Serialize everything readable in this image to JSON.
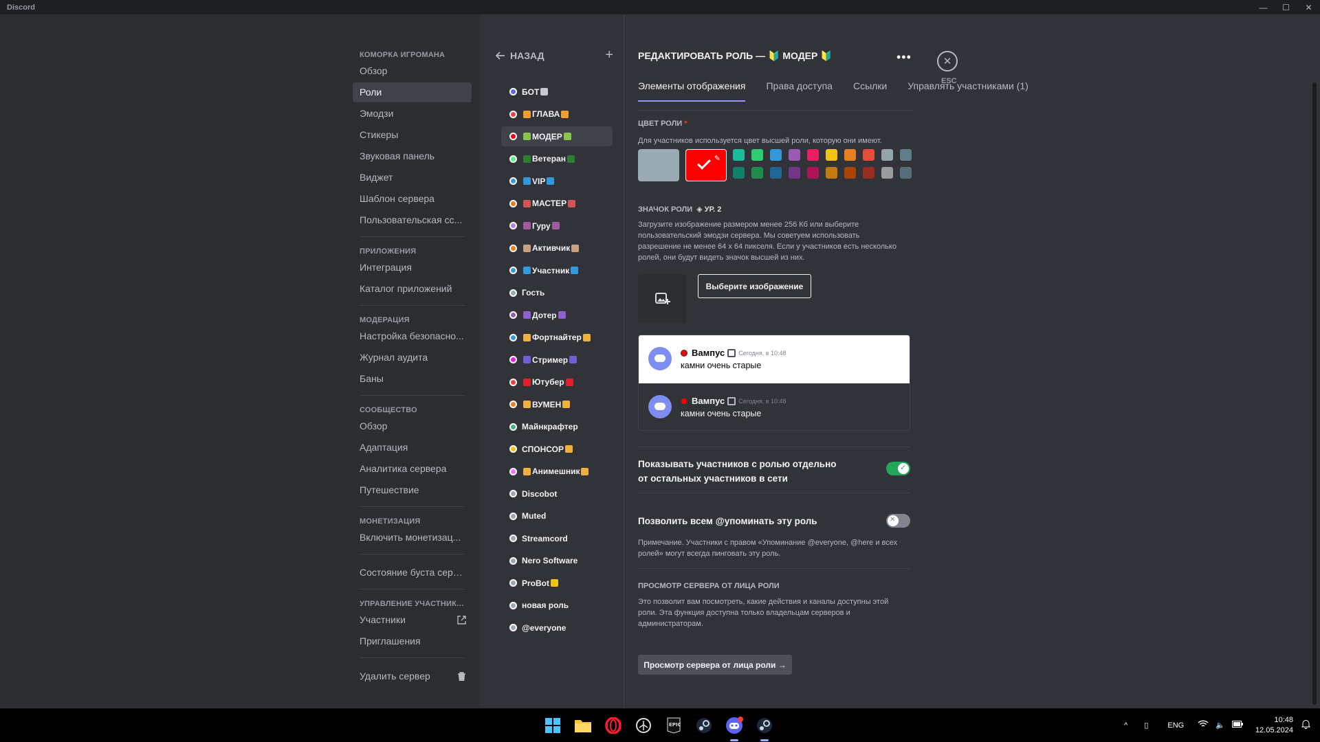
{
  "window": {
    "title": "Discord"
  },
  "sidebar": {
    "sections": [
      {
        "header": "КОМОРКА ИГРОМАНА",
        "items": [
          "Обзор",
          "Роли",
          "Эмодзи",
          "Стикеры",
          "Звуковая панель",
          "Виджет",
          "Шаблон сервера",
          "Пользовательская сс..."
        ]
      },
      {
        "header": "ПРИЛОЖЕНИЯ",
        "items": [
          "Интеграция",
          "Каталог приложений"
        ]
      },
      {
        "header": "МОДЕРАЦИЯ",
        "items": [
          "Настройка безопасно...",
          "Журнал аудита",
          "Баны"
        ]
      },
      {
        "header": "СООБЩЕСТВО",
        "items": [
          "Обзор",
          "Адаптация",
          "Аналитика сервера",
          "Путешествие"
        ]
      },
      {
        "header": "МОНЕТИЗАЦИЯ",
        "items": [
          "Включить монетизац..."
        ]
      },
      {
        "header": "",
        "items": [
          "Состояние буста сервера"
        ]
      },
      {
        "header": "УПРАВЛЕНИЕ УЧАСТНИКА...",
        "items": [
          "Участники",
          "Приглашения"
        ]
      },
      {
        "header": "",
        "items": [
          "Удалить сервер"
        ]
      }
    ],
    "active_item": "Роли"
  },
  "roles": {
    "back_label": "НАЗАД",
    "items": [
      {
        "name": "БОТ",
        "color": "#5865f2",
        "pre": "",
        "post": "#c7c7d0"
      },
      {
        "name": "ГЛАВА",
        "color": "#f23f43",
        "pre": "#f0a030",
        "post": "#f0a030"
      },
      {
        "name": "МОДЕР",
        "color": "#ff0000",
        "pre": "#8bc34a",
        "post": "#8bc34a"
      },
      {
        "name": "Ветеран",
        "color": "#57f287",
        "pre": "#2e7d32",
        "post": "#2e7d32"
      },
      {
        "name": "VIP",
        "color": "#3498db",
        "pre": "#3498db",
        "post": "#3498db"
      },
      {
        "name": "МАСТЕР",
        "color": "#e67e22",
        "pre": "#d35454",
        "post": "#d35454"
      },
      {
        "name": "Гуру",
        "color": "#c27ce0",
        "pre": "#a05aa0",
        "post": "#a05aa0"
      },
      {
        "name": "Активчик",
        "color": "#e67e22",
        "pre": "#c9a080",
        "post": "#c9a080"
      },
      {
        "name": "Участник",
        "color": "#3498db",
        "pre": "#3498db",
        "post": "#3498db"
      },
      {
        "name": "Гость",
        "color": "#99aab5",
        "pre": "",
        "post": ""
      },
      {
        "name": "Дотер",
        "color": "#9b59b6",
        "pre": "#8e5fd0",
        "post": "#8e5fd0"
      },
      {
        "name": "Фортнайтер",
        "color": "#3498db",
        "pre": "#f0b040",
        "post": "#f0b040"
      },
      {
        "name": "Стример",
        "color": "#e91ee3",
        "pre": "#6f5fd6",
        "post": "#6f5fd6"
      },
      {
        "name": "Ютубер",
        "color": "#f23f43",
        "pre": "#e0202a",
        "post": "#e0202a"
      },
      {
        "name": "ВУМЕН",
        "color": "#e67e22",
        "pre": "#f0b040",
        "post": "#f0b040"
      },
      {
        "name": "Майнкрафтер",
        "color": "#43b581",
        "pre": "",
        "post": ""
      },
      {
        "name": "СПОНСОР",
        "color": "#f1c40f",
        "pre": "",
        "post": "#f0b040"
      },
      {
        "name": "Анимешник",
        "color": "#ff73fa",
        "pre": "#f0b040",
        "post": "#f0b040"
      },
      {
        "name": "Discobot",
        "color": "#99aab5",
        "pre": "",
        "post": ""
      },
      {
        "name": "Muted",
        "color": "#99aab5",
        "pre": "",
        "post": ""
      },
      {
        "name": "Streamcord",
        "color": "#99aab5",
        "pre": "",
        "post": ""
      },
      {
        "name": "Nero Software",
        "color": "#99aab5",
        "pre": "",
        "post": ""
      },
      {
        "name": "ProBot",
        "color": "#99aab5",
        "pre": "",
        "post": "#f1c40f"
      },
      {
        "name": "новая роль",
        "color": "#99aab5",
        "pre": "",
        "post": ""
      },
      {
        "name": "@everyone",
        "color": "#99aab5",
        "pre": "",
        "post": ""
      }
    ],
    "active_role": "МОДЕР"
  },
  "edit": {
    "title": "РЕДАКТИРОВАТЬ РОЛЬ — 🔰 МОДЕР 🔰",
    "tabs": [
      "Элементы отображения",
      "Права доступа",
      "Ссылки",
      "Управлять участниками (1)"
    ],
    "active_tab": "Элементы отображения",
    "color_label": "ЦВЕТ РОЛИ",
    "color_required_mark": "*",
    "color_desc": "Для участников используется цвет высшей роли, которую они имеют.",
    "default_color": "#99aab5",
    "selected_color": "#ff0000",
    "palette": [
      "#1abc9c",
      "#2ecc71",
      "#3498db",
      "#9b59b6",
      "#e91e63",
      "#f1c40f",
      "#e67e22",
      "#e74c3c",
      "#95a5a6",
      "#607d8b",
      "#11806a",
      "#1f8b4c",
      "#206694",
      "#71368a",
      "#ad1457",
      "#c27c0e",
      "#a84300",
      "#992d22",
      "#979c9f",
      "#546e7a"
    ],
    "icon_label": "ЗНАЧОК РОЛИ",
    "icon_level": "УР. 2",
    "icon_desc": "Загрузите изображение размером менее 256 Кб или выберите пользовательский эмодзи сервера. Мы советуем использовать разрешение не менее 64 x 64 пикселя. Если у участников есть несколько ролей, они будут видеть значок высшей из них.",
    "pick_image_label": "Выберите изображение",
    "preview": {
      "username": "Вампус",
      "timestamp": "Сегодня, в 10:48",
      "message": "камни очень старые"
    },
    "hoist_label": "Показывать участников с ролью отдельно от остальных участников в сети",
    "hoist_on": true,
    "mention_label": "Позволить всем @упоминать эту роль",
    "mention_on": false,
    "mention_note": "Примечание. Участники с правом «Упоминание @everyone, @here и всех ролей» могут всегда пинговать эту роль.",
    "view_as_header": "ПРОСМОТР СЕРВЕРА ОТ ЛИЦА РОЛИ",
    "view_as_desc": "Это позволит вам посмотреть, какие действия и каналы доступны этой роли. Эта функция доступна только владельцам серверов и администраторам.",
    "view_as_button": "Просмотр сервера от лица роли →"
  },
  "esc_label": "ESC",
  "taskbar": {
    "lang": "ENG",
    "time": "10:48",
    "date": "12.05.2024",
    "apps": [
      "windows-start",
      "file-explorer",
      "opera",
      "unity",
      "epic-games",
      "steam",
      "discord",
      "steam-2"
    ]
  }
}
